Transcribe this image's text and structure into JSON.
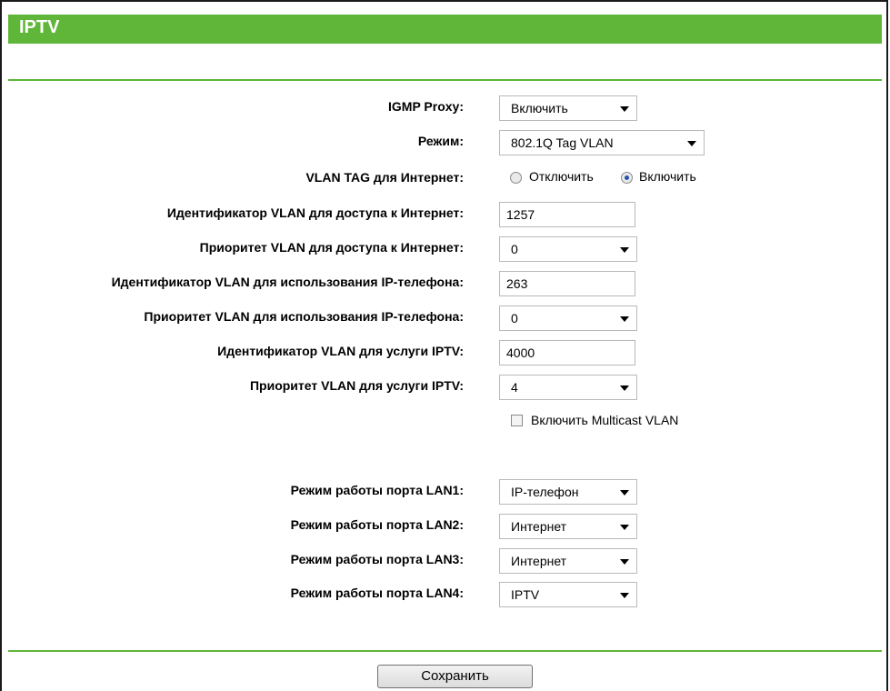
{
  "header": {
    "title": "IPTV"
  },
  "form": {
    "igmp_proxy": {
      "label": "IGMP Proxy:",
      "value": "Включить"
    },
    "mode": {
      "label": "Режим:",
      "value": "802.1Q Tag VLAN"
    },
    "vlan_tag_internet": {
      "label": "VLAN TAG для Интернет:",
      "option_off": "Отключить",
      "option_on": "Включить",
      "selected": "Включить"
    },
    "internet_vlan_id": {
      "label": "Идентификатор VLAN для доступа к Интернет:",
      "value": "1257"
    },
    "internet_vlan_priority": {
      "label": "Приоритет VLAN для доступа к Интернет:",
      "value": "0"
    },
    "ipphone_vlan_id": {
      "label": "Идентификатор VLAN для использования IP-телефона:",
      "value": "263"
    },
    "ipphone_vlan_priority": {
      "label": "Приоритет VLAN для использования IP-телефона:",
      "value": "0"
    },
    "iptv_vlan_id": {
      "label": "Идентификатор VLAN для услуги IPTV:",
      "value": "4000"
    },
    "iptv_vlan_priority": {
      "label": "Приоритет VLAN для услуги IPTV:",
      "value": "4"
    },
    "multicast_vlan": {
      "label": "Включить Multicast VLAN",
      "checked": false
    },
    "lan1": {
      "label": "Режим работы порта LAN1:",
      "value": "IP-телефон"
    },
    "lan2": {
      "label": "Режим работы порта LAN2:",
      "value": "Интернет"
    },
    "lan3": {
      "label": "Режим работы порта LAN3:",
      "value": "Интернет"
    },
    "lan4": {
      "label": "Режим работы порта LAN4:",
      "value": "IPTV"
    }
  },
  "actions": {
    "save_label": "Сохранить"
  },
  "colors": {
    "accent": "#5fb639"
  }
}
